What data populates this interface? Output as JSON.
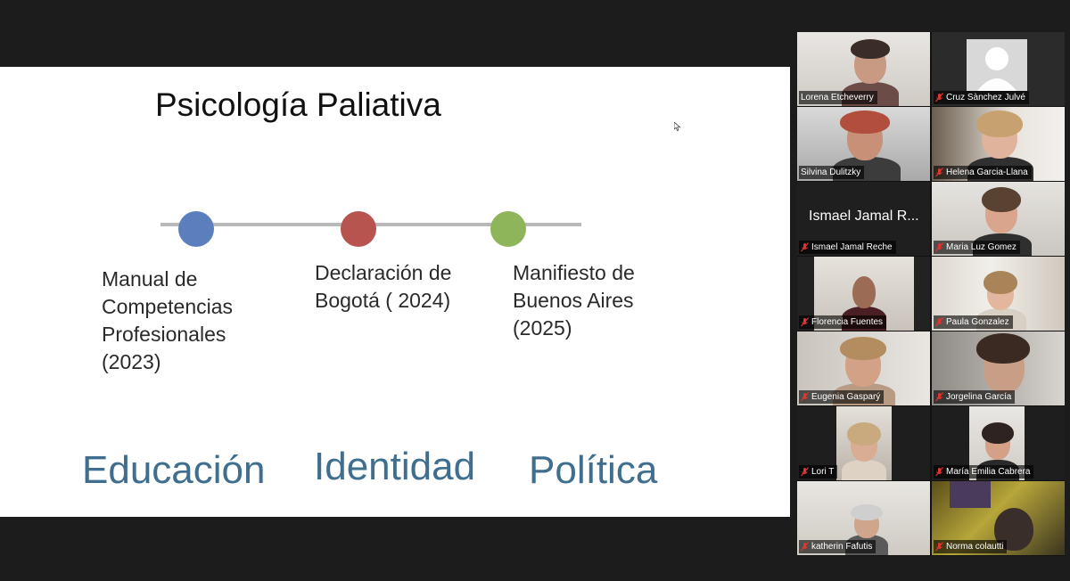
{
  "slide": {
    "title": "Psicología Paliativa",
    "milestones": [
      {
        "text": "Manual de\nCompetencias\n Profesionales\n (2023)",
        "color": "#5b7fbd"
      },
      {
        "text": "Declaración de\nBogotá ( 2024)",
        "color": "#b85450"
      },
      {
        "text": "Manifiesto de\nBuenos Aires\n(2025)",
        "color": "#8fb55a"
      }
    ],
    "themes": [
      "Educación",
      "Identidad",
      "Política"
    ]
  },
  "participants": [
    {
      "name": "Lorena Etcheverry",
      "muted": false
    },
    {
      "name": "Cruz Sànchez Julvé",
      "muted": true
    },
    {
      "name": "Silvina Dulitzky",
      "muted": false,
      "active": true
    },
    {
      "name": "Helena Garcia-Llana",
      "muted": true
    },
    {
      "name": "Ismael Jamal Reche",
      "muted": true,
      "display_name": "Ismael Jamal R..."
    },
    {
      "name": "Maria Luz Gomez",
      "muted": true
    },
    {
      "name": "Florencia Fuentes",
      "muted": true
    },
    {
      "name": "Paula Gonzalez",
      "muted": true
    },
    {
      "name": "Eugenia Gasparý",
      "muted": true
    },
    {
      "name": "Jorgelina García",
      "muted": true
    },
    {
      "name": "Lori T",
      "muted": true
    },
    {
      "name": "María Emilia Cabrera",
      "muted": true
    },
    {
      "name": "katherin Fafutis",
      "muted": true
    },
    {
      "name": "Norma colautti",
      "muted": true
    }
  ],
  "colors": {
    "active_speaker": "#33c046",
    "muted_icon": "#e0342f",
    "theme_text": "#3f6e8f"
  },
  "icons": {
    "muted": "microphone-muted-icon",
    "avatar": "user-avatar-icon",
    "cursor": "mouse-cursor-icon"
  }
}
